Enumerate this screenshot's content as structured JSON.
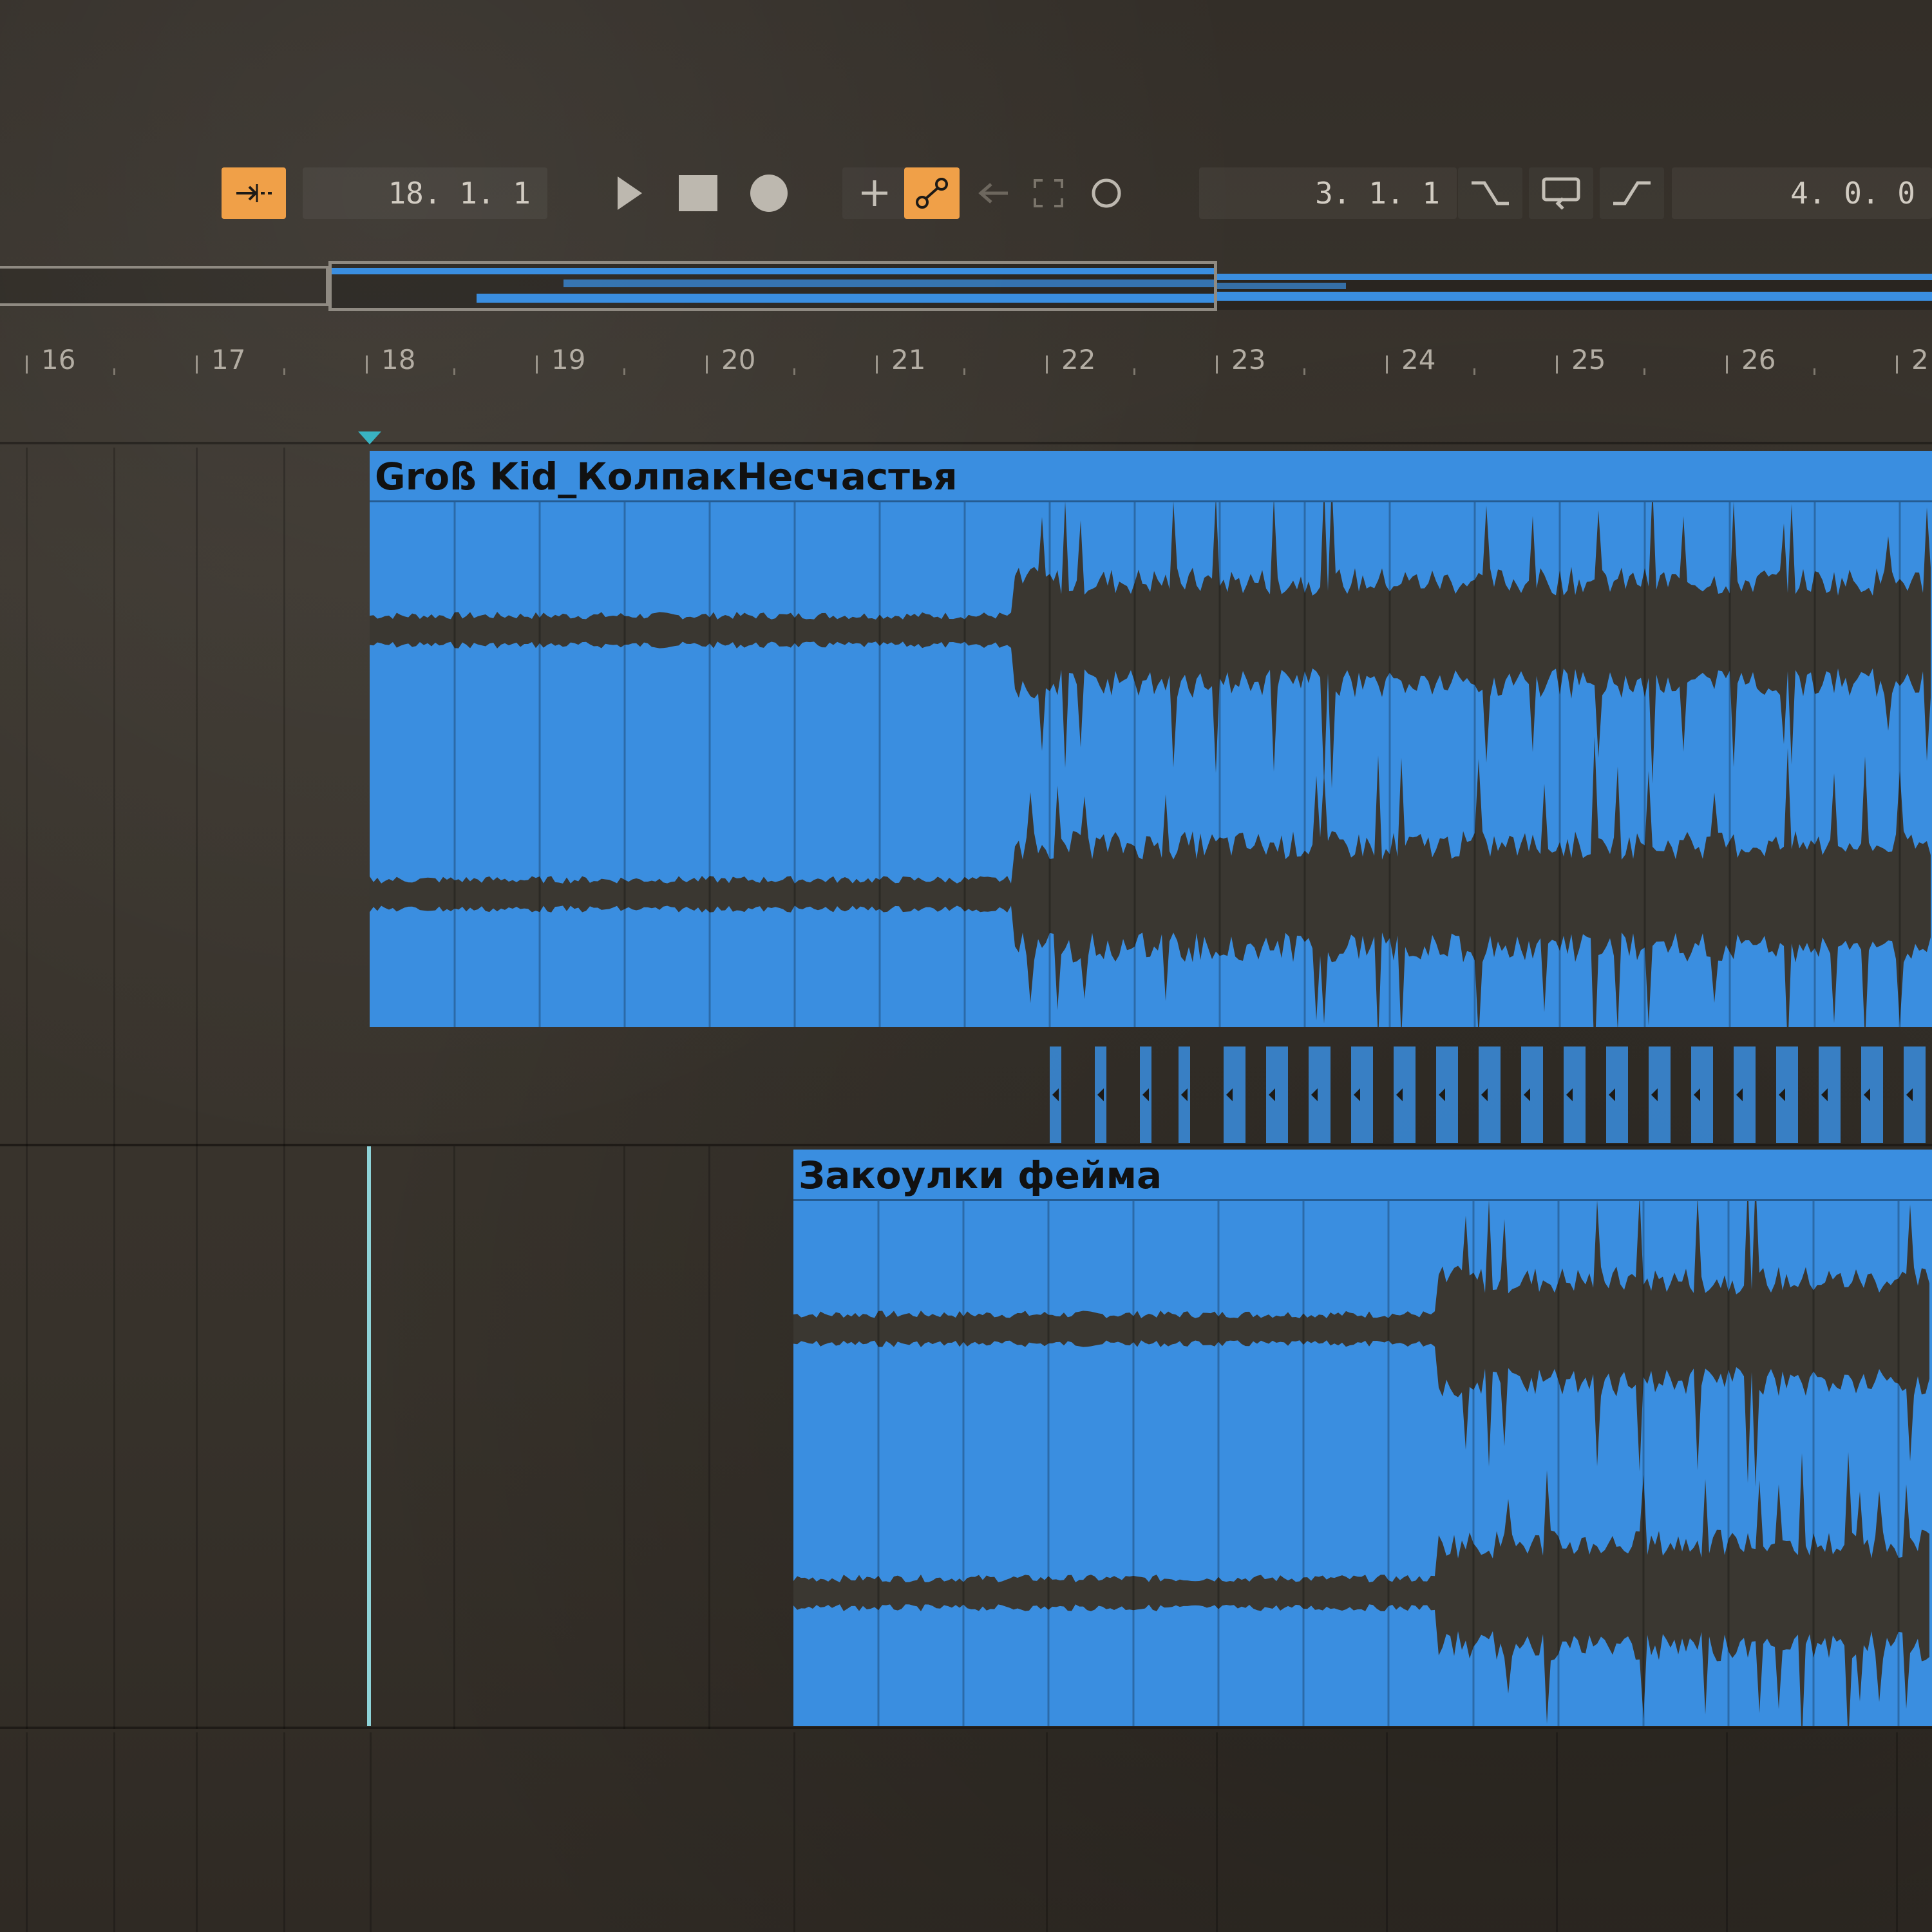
{
  "colors": {
    "accent_orange": "#f0a048",
    "clip_blue": "#3a8ee0",
    "waveform": "#3a3731",
    "playhead": "#8ed3d8",
    "loop_marker": "#39b3c2"
  },
  "transport": {
    "follow_button_icon": "follow-playhead-icon",
    "position": "18. 1. 1",
    "play_icon": "play-icon",
    "stop_icon": "stop-icon",
    "record_icon": "record-icon",
    "add_icon": "plus-icon",
    "automation_icon": "automation-arm-icon",
    "back_icon": "back-arrow-icon",
    "punch_icon": "punch-in-out-icon",
    "session_record_icon": "circle-icon",
    "loop_start": "3. 1. 1",
    "punch_in_icon": "punch-in-icon",
    "loop_toggle_icon": "loop-icon",
    "punch_out_icon": "punch-out-icon",
    "loop_length": "4. 0. 0"
  },
  "ruler": {
    "bars": [
      "16",
      "17",
      "18",
      "19",
      "20",
      "21",
      "22",
      "23",
      "24",
      "25",
      "26",
      "2"
    ]
  },
  "tracks": [
    {
      "clip_name": "Groß Kid_КолпакНесчастья"
    },
    {
      "clip_name": "Закоулки фейма"
    }
  ]
}
